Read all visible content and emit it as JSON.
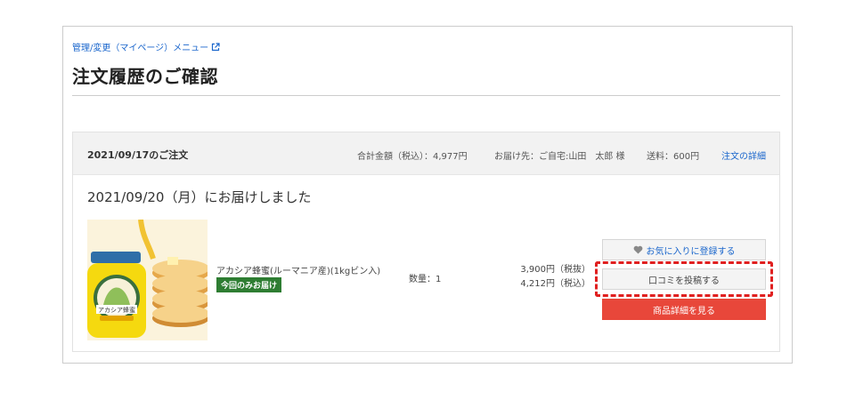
{
  "header": {
    "menu_link": "管理/変更（マイページ）メニュー",
    "title": "注文履歴のご確認"
  },
  "order": {
    "date_label": "2021/09/17のご注文",
    "total": "合計金額（税込）：4,977円",
    "destination": "お届け先：ご自宅:山田　太郎 様",
    "shipping": "送料：600円",
    "detail_link": "注文の詳細",
    "delivered": "2021/09/20（月）にお届けしました",
    "item": {
      "name": "アカシア蜂蜜(ルーマニア産)(1kgビン入)",
      "badge": "今回のみお届け",
      "quantity": "数量：1",
      "price_excl": "3,900円（税抜）",
      "price_incl": "4,212円（税込）",
      "jar_label": "アカシア蜂蜜"
    },
    "buttons": {
      "favorite": "お気に入りに登録する",
      "review": "口コミを投稿する",
      "detail": "商品詳細を見る"
    }
  },
  "colors": {
    "link": "#1a66cc",
    "badge": "#2e7d32",
    "primary_button": "#e8473a",
    "highlight": "#e02020"
  }
}
